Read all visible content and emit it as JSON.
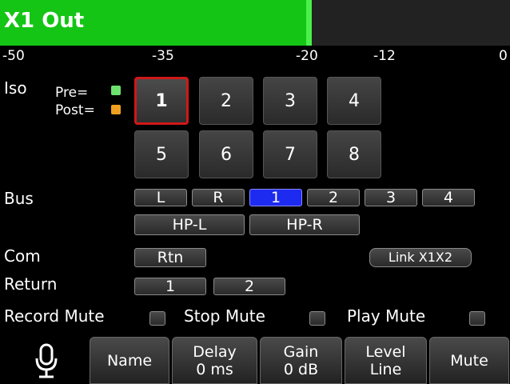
{
  "header": {
    "title": "X1 Out",
    "meter_level_fraction": 0.61,
    "meter_color": "#15c515"
  },
  "scale": {
    "ticks": [
      "-50",
      "-35",
      "-20",
      "-12",
      "0"
    ]
  },
  "iso": {
    "label": "Iso",
    "legend_pre": "Pre=",
    "legend_post": "Post=",
    "pre_color": "#6ee06e",
    "post_color": "#f0a020",
    "buttons": [
      "1",
      "2",
      "3",
      "4",
      "5",
      "6",
      "7",
      "8"
    ],
    "selected": "1"
  },
  "bus": {
    "label": "Bus",
    "buttons": [
      "L",
      "R",
      "1",
      "2",
      "3",
      "4"
    ],
    "active": "1",
    "hp_buttons": [
      "HP-L",
      "HP-R"
    ]
  },
  "com": {
    "label": "Com",
    "rtn": "Rtn",
    "link": "Link X1X2"
  },
  "return": {
    "label": "Return",
    "buttons": [
      "1",
      "2"
    ]
  },
  "mutes": {
    "record": "Record Mute",
    "stop": "Stop Mute",
    "play": "Play Mute"
  },
  "toolbar": {
    "mic_icon": "microphone-icon",
    "name": "Name",
    "delay_label": "Delay",
    "delay_value": "0 ms",
    "gain_label": "Gain",
    "gain_value": "0 dB",
    "level_label": "Level",
    "level_value": "Line",
    "mute": "Mute"
  }
}
